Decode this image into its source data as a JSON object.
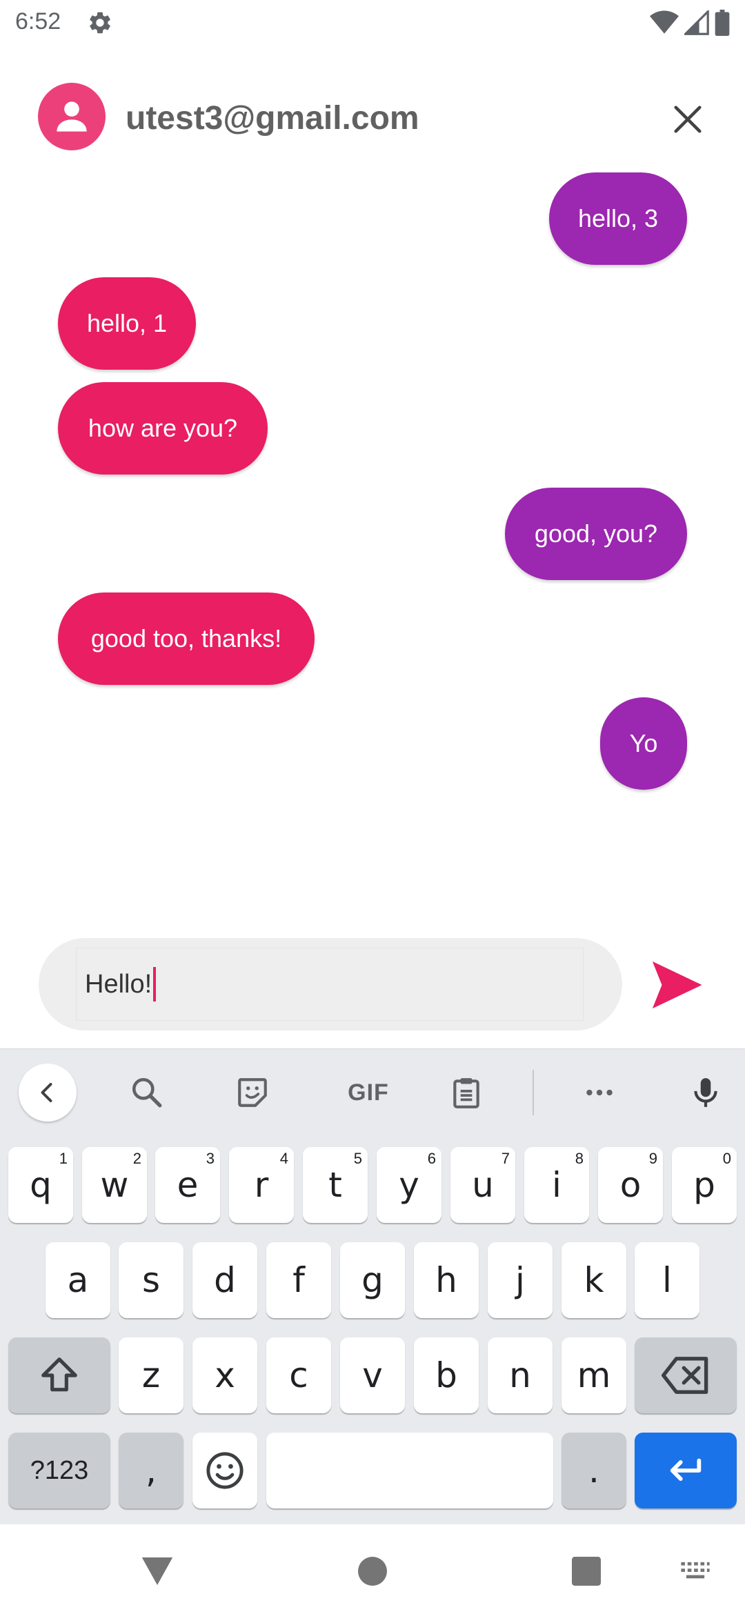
{
  "status_bar": {
    "time": "6:52",
    "icons": [
      "gear-icon",
      "wifi-icon",
      "signal-icon",
      "battery-icon"
    ]
  },
  "header": {
    "contact": "utest3@gmail.com",
    "avatar_icon": "person-icon",
    "close_icon": "close-icon"
  },
  "messages": [
    {
      "text": "hello, 3",
      "direction": "sent"
    },
    {
      "text": "hello, 1",
      "direction": "received"
    },
    {
      "text": "how are you?",
      "direction": "received"
    },
    {
      "text": "good, you?",
      "direction": "sent"
    },
    {
      "text": "good too, thanks!",
      "direction": "received"
    },
    {
      "text": "Yo",
      "direction": "sent"
    }
  ],
  "composer": {
    "value": "Hello!",
    "send_icon": "send-icon"
  },
  "keyboard": {
    "toolbar": [
      "chevron-left-icon",
      "search-icon",
      "sticker-icon",
      "GIF",
      "clipboard-icon",
      "more-icon",
      "mic-icon"
    ],
    "gif_label": "GIF",
    "row1": [
      {
        "key": "q",
        "hint": "1"
      },
      {
        "key": "w",
        "hint": "2"
      },
      {
        "key": "e",
        "hint": "3"
      },
      {
        "key": "r",
        "hint": "4"
      },
      {
        "key": "t",
        "hint": "5"
      },
      {
        "key": "y",
        "hint": "6"
      },
      {
        "key": "u",
        "hint": "7"
      },
      {
        "key": "i",
        "hint": "8"
      },
      {
        "key": "o",
        "hint": "9"
      },
      {
        "key": "p",
        "hint": "0"
      }
    ],
    "row2": [
      "a",
      "s",
      "d",
      "f",
      "g",
      "h",
      "j",
      "k",
      "l"
    ],
    "row3": [
      "z",
      "x",
      "c",
      "v",
      "b",
      "n",
      "m"
    ],
    "symbols_label": "?123",
    "comma": ",",
    "period": ".",
    "shift_icon": "shift-icon",
    "backspace_icon": "backspace-icon",
    "emoji_icon": "emoji-icon",
    "enter_icon": "enter-icon"
  },
  "navbar": {
    "icons": [
      "back-icon",
      "home-icon",
      "recents-icon",
      "keyboard-switch-icon"
    ]
  },
  "colors": {
    "sent_bubble": "#9c27b0",
    "received_bubble": "#e91e63",
    "accent": "#e91e63",
    "enter_key": "#1a73e8"
  }
}
